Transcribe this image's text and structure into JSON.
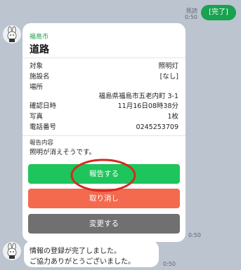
{
  "outgoing": {
    "read": "既読",
    "time": "0:50",
    "text": "[完了]"
  },
  "card": {
    "org": "福島市",
    "title": "道路",
    "fields": [
      {
        "label": "対象",
        "value": "照明灯"
      },
      {
        "label": "施設名",
        "value": "[なし]"
      },
      {
        "label": "場所",
        "value": "福島県福島市五老内町 3-1"
      },
      {
        "label": "確認日時",
        "value": "11月16日08時38分"
      },
      {
        "label": "写真",
        "value": "1枚"
      },
      {
        "label": "電話番号",
        "value": "0245253709"
      }
    ],
    "report_label": "報告内容",
    "report_text": "照明が消えそうです。",
    "buttons": {
      "report": "報告する",
      "cancel": "取り消し",
      "change": "変更する"
    },
    "time": "0:50"
  },
  "message": {
    "line1": "情報の登録が完了しました。",
    "line2": "ご協力ありがとうございました。",
    "time": "0:50"
  },
  "colors": {
    "green": "#1ec55c",
    "red": "#f36a4e",
    "gray": "#707070",
    "annotation": "#d42a20",
    "bg": "#bcc4cf"
  }
}
